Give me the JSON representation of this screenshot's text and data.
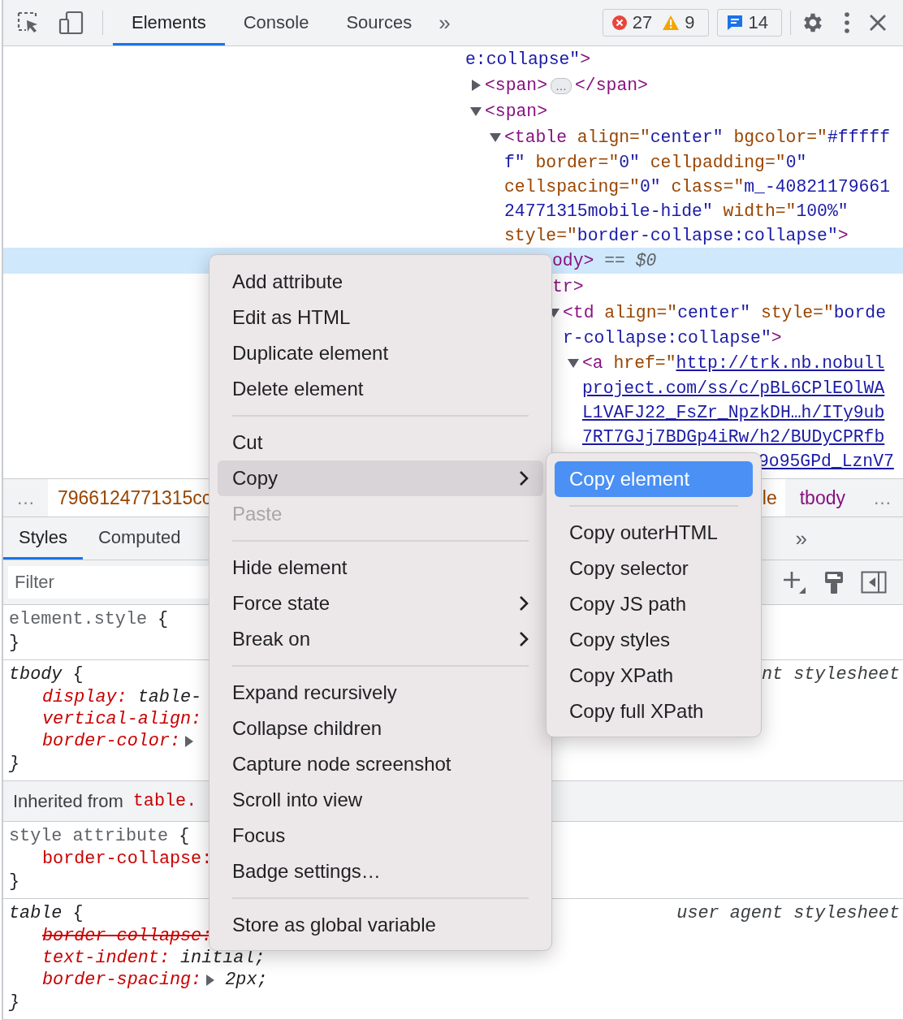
{
  "toolbar": {
    "tabs": [
      {
        "label": "Elements",
        "selected": true
      },
      {
        "label": "Console",
        "selected": false
      },
      {
        "label": "Sources",
        "selected": false
      }
    ],
    "more": "»",
    "errors": "27",
    "warnings": "9",
    "messages": "14"
  },
  "tree": [
    {
      "selected": false,
      "lines": [
        {
          "segs": [
            {
              "kind": "value",
              "text": "e:collapse\""
            },
            {
              "kind": "tag",
              "text": ">"
            }
          ]
        }
      ],
      "children": [
        {
          "selected": false,
          "expanded": false,
          "lines": [
            {
              "segs": [
                {
                  "kind": "tag",
                  "text": "<span>"
                },
                {
                  "kind": "pill",
                  "text": "…"
                },
                {
                  "kind": "tag",
                  "text": "</span>"
                }
              ]
            }
          ]
        },
        {
          "selected": false,
          "expanded": true,
          "lines": [
            {
              "segs": [
                {
                  "kind": "tag",
                  "text": "<span>"
                }
              ]
            }
          ],
          "children": [
            {
              "selected": false,
              "expanded": true,
              "lines": [
                {
                  "segs": [
                    {
                      "kind": "tag",
                      "text": "<table"
                    },
                    {
                      "kind": "attr",
                      "text": " align=\""
                    },
                    {
                      "kind": "value",
                      "text": "center\""
                    },
                    {
                      "kind": "attr",
                      "text": " bgcolor=\""
                    },
                    {
                      "kind": "value",
                      "text": "#fffff"
                    }
                  ]
                },
                {
                  "segs": [
                    {
                      "kind": "value",
                      "text": "f\""
                    },
                    {
                      "kind": "attr",
                      "text": " border=\""
                    },
                    {
                      "kind": "value",
                      "text": "0\""
                    },
                    {
                      "kind": "attr",
                      "text": " cellpadding=\""
                    },
                    {
                      "kind": "value",
                      "text": "0\""
                    }
                  ]
                },
                {
                  "segs": [
                    {
                      "kind": "attr",
                      "text": "cellspacing=\""
                    },
                    {
                      "kind": "value",
                      "text": "0\""
                    },
                    {
                      "kind": "attr",
                      "text": " class=\""
                    },
                    {
                      "kind": "value",
                      "text": "m_-40821179661"
                    }
                  ]
                },
                {
                  "segs": [
                    {
                      "kind": "value",
                      "text": "24771315mobile-hide\""
                    },
                    {
                      "kind": "attr",
                      "text": " width=\""
                    },
                    {
                      "kind": "value",
                      "text": "100%\""
                    }
                  ]
                },
                {
                  "segs": [
                    {
                      "kind": "attr",
                      "text": "style=\""
                    },
                    {
                      "kind": "value",
                      "text": "border-collapse:collapse\""
                    },
                    {
                      "kind": "tag",
                      "text": ">"
                    }
                  ]
                }
              ],
              "children": [
                {
                  "selected": true,
                  "lines": [
                    {
                      "under_menu": true,
                      "segs": [
                        {
                          "kind": "tag",
                          "text": "ody>"
                        },
                        {
                          "kind": "ref",
                          "text": " == $0"
                        }
                      ]
                    }
                  ],
                  "children": [
                    {
                      "selected": false,
                      "lines": [
                        {
                          "under_menu": true,
                          "segs": [
                            {
                              "kind": "tag",
                              "text": "tr>"
                            }
                          ]
                        }
                      ],
                      "children": [
                        {
                          "selected": false,
                          "expanded": true,
                          "lines": [
                            {
                              "segs": [
                                {
                                  "kind": "tag",
                                  "text": "<td"
                                },
                                {
                                  "kind": "attr",
                                  "text": " align=\""
                                },
                                {
                                  "kind": "value",
                                  "text": "center\""
                                },
                                {
                                  "kind": "attr",
                                  "text": " style=\""
                                },
                                {
                                  "kind": "value",
                                  "text": "borde"
                                }
                              ]
                            },
                            {
                              "segs": [
                                {
                                  "kind": "value",
                                  "text": "r-collapse:collapse\""
                                },
                                {
                                  "kind": "tag",
                                  "text": ">"
                                }
                              ]
                            }
                          ],
                          "children": [
                            {
                              "selected": false,
                              "expanded": true,
                              "lines": [
                                {
                                  "segs": [
                                    {
                                      "kind": "tag",
                                      "text": "<a"
                                    },
                                    {
                                      "kind": "attr",
                                      "text": " href=\""
                                    },
                                    {
                                      "kind": "link",
                                      "text": "http://trk.nb.nobull"
                                    }
                                  ]
                                },
                                {
                                  "segs": [
                                    {
                                      "kind": "link",
                                      "text": "project.com/ss/c/pBL6CPlEOlWA"
                                    }
                                  ]
                                },
                                {
                                  "segs": [
                                    {
                                      "kind": "link",
                                      "text": "L1VAFJ22_FsZr_NpzkDH…h/ITy9ub"
                                    }
                                  ]
                                },
                                {
                                  "segs": [
                                    {
                                      "kind": "link",
                                      "text": "7RT7GJj7BDGp4iRw/h2/BUDyCPRfb"
                                    }
                                  ]
                                },
                                {
                                  "under_submenu": true,
                                  "segs": [
                                    {
                                      "kind": "link",
                                      "text": "9o95GPd_LznV7"
                                    }
                                  ]
                                }
                              ]
                            }
                          ]
                        }
                      ]
                    }
                  ]
                }
              ]
            }
          ]
        }
      ]
    }
  ],
  "breadcrumbs": {
    "left": [
      {
        "kind": "more",
        "label": "…",
        "selected": false
      },
      {
        "kind": "attr",
        "label": "7966124771315cc",
        "selected": false
      }
    ],
    "right": [
      {
        "kind": "attr",
        "label": "le",
        "selected": false
      },
      {
        "kind": "tag",
        "label": "tbody",
        "selected": true
      },
      {
        "kind": "more",
        "label": "…",
        "selected": false
      }
    ]
  },
  "pane_tabs": [
    {
      "label": "Styles",
      "selected": true
    },
    {
      "label": "Computed",
      "selected": false
    }
  ],
  "pane_more": "»",
  "filter": {
    "placeholder": "Filter"
  },
  "rules": [
    {
      "kind": "rule",
      "user_agent": false,
      "selector": "element.style",
      "open": "{",
      "close": "}"
    },
    {
      "kind": "rule",
      "user_agent": true,
      "selector": "tbody",
      "open": "{",
      "close": "}",
      "source": "nt stylesheet",
      "props": [
        {
          "name": "display:",
          "value": "table-",
          "overridden": false,
          "expandable": false
        },
        {
          "name": "vertical-align:",
          "overridden": false,
          "expandable": false
        },
        {
          "name": "border-color:",
          "overridden": false,
          "expandable": true
        }
      ]
    },
    {
      "kind": "inherited",
      "label": "Inherited from",
      "target": "table."
    },
    {
      "kind": "rule",
      "user_agent": false,
      "selector": "style attribute",
      "open": "{",
      "close": "}",
      "props": [
        {
          "name": "border-collapse:",
          "overridden": false,
          "expandable": false
        }
      ]
    },
    {
      "kind": "rule",
      "user_agent": true,
      "selector": "table",
      "open": "{",
      "close": "}",
      "source": "user agent stylesheet",
      "props": [
        {
          "name": "border-collapse:",
          "overridden": true,
          "expandable": false
        },
        {
          "name": "text-indent:",
          "value": "initial;",
          "overridden": false,
          "expandable": false
        },
        {
          "name": "border-spacing:",
          "value": "2px;",
          "overridden": false,
          "expandable": true
        }
      ]
    }
  ],
  "menu": [
    {
      "kind": "item",
      "label": "Add attribute",
      "disabled": false,
      "highlighted": false,
      "submenu": false
    },
    {
      "kind": "item",
      "label": "Edit as HTML",
      "disabled": false,
      "highlighted": false,
      "submenu": false
    },
    {
      "kind": "item",
      "label": "Duplicate element",
      "disabled": false,
      "highlighted": false,
      "submenu": false
    },
    {
      "kind": "item",
      "label": "Delete element",
      "disabled": false,
      "highlighted": false,
      "submenu": false
    },
    {
      "kind": "separator"
    },
    {
      "kind": "item",
      "label": "Cut",
      "disabled": false,
      "highlighted": false,
      "submenu": false
    },
    {
      "kind": "item",
      "label": "Copy",
      "disabled": false,
      "highlighted": true,
      "submenu": true
    },
    {
      "kind": "item",
      "label": "Paste",
      "disabled": true,
      "highlighted": false,
      "submenu": false
    },
    {
      "kind": "separator"
    },
    {
      "kind": "item",
      "label": "Hide element",
      "disabled": false,
      "highlighted": false,
      "submenu": false
    },
    {
      "kind": "item",
      "label": "Force state",
      "disabled": false,
      "highlighted": false,
      "submenu": true
    },
    {
      "kind": "item",
      "label": "Break on",
      "disabled": false,
      "highlighted": false,
      "submenu": true
    },
    {
      "kind": "separator"
    },
    {
      "kind": "item",
      "label": "Expand recursively",
      "disabled": false,
      "highlighted": false,
      "submenu": false
    },
    {
      "kind": "item",
      "label": "Collapse children",
      "disabled": false,
      "highlighted": false,
      "submenu": false
    },
    {
      "kind": "item",
      "label": "Capture node screenshot",
      "disabled": false,
      "highlighted": false,
      "submenu": false
    },
    {
      "kind": "item",
      "label": "Scroll into view",
      "disabled": false,
      "highlighted": false,
      "submenu": false
    },
    {
      "kind": "item",
      "label": "Focus",
      "disabled": false,
      "highlighted": false,
      "submenu": false
    },
    {
      "kind": "item",
      "label": "Badge settings…",
      "disabled": false,
      "highlighted": false,
      "submenu": false
    },
    {
      "kind": "separator"
    },
    {
      "kind": "item",
      "label": "Store as global variable",
      "disabled": false,
      "highlighted": false,
      "submenu": false
    }
  ],
  "submenu": [
    {
      "kind": "item",
      "label": "Copy element",
      "disabled": false,
      "highlighted": true
    },
    {
      "kind": "separator"
    },
    {
      "kind": "item",
      "label": "Copy outerHTML",
      "disabled": false,
      "highlighted": false
    },
    {
      "kind": "item",
      "label": "Copy selector",
      "disabled": false,
      "highlighted": false
    },
    {
      "kind": "item",
      "label": "Copy JS path",
      "disabled": false,
      "highlighted": false
    },
    {
      "kind": "item",
      "label": "Copy styles",
      "disabled": false,
      "highlighted": false
    },
    {
      "kind": "item",
      "label": "Copy XPath",
      "disabled": false,
      "highlighted": false
    },
    {
      "kind": "item",
      "label": "Copy full XPath",
      "disabled": false,
      "highlighted": false
    }
  ]
}
